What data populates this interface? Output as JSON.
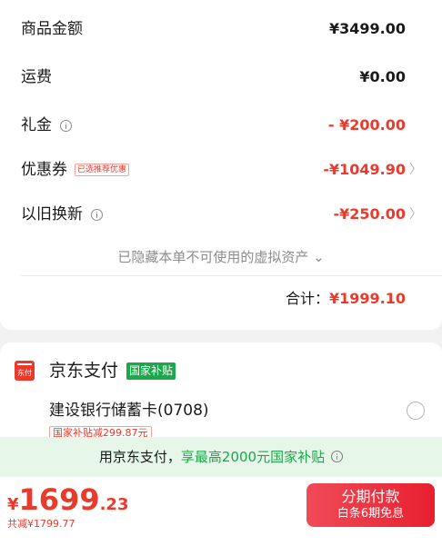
{
  "summary": {
    "items": [
      {
        "label": "商品金额",
        "value": "¥3499.00"
      },
      {
        "label": "运费",
        "value": "¥0.00"
      },
      {
        "label": "礼金",
        "value": "- ¥200.00"
      },
      {
        "label": "优惠券",
        "tag": "已选推荐优惠",
        "value": "-¥1049.90"
      },
      {
        "label": "以旧换新",
        "value": "-¥250.00"
      }
    ],
    "hidden_note": "已隐藏本单不可使用的虚拟资产",
    "hidden_chevron": "⌄",
    "total_label": "合计：",
    "total_value": "¥1999.10",
    "chevron": "〉"
  },
  "payment": {
    "logo_text": "东付",
    "title": "京东支付",
    "badge": "国家补贴",
    "bank": "建设银行储蓄卡(0708)",
    "subsidy_tag": "国家补贴减299.87元"
  },
  "banner": {
    "prefix": "用京东支付，",
    "highlight": "享最高2000元国家补贴"
  },
  "footer": {
    "currency": "¥",
    "price_int": "1699",
    "price_dec": ".23",
    "saved": "共减¥1799.77",
    "button_line1": "分期付款",
    "button_line2": "白条6期免息"
  },
  "colors": {
    "red": "#e93a2b",
    "green": "#1aa84a",
    "banner_bg": "#e6f7e9"
  }
}
